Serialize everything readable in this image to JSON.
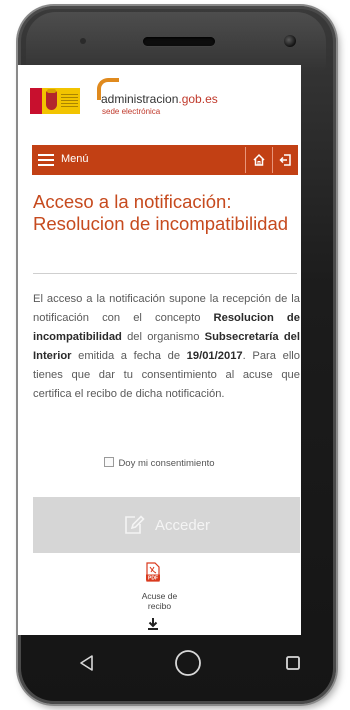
{
  "header": {
    "brand_main": "administracion",
    "brand_suffix": ".gob.es",
    "brand_sub": "sede electrónica"
  },
  "menubar": {
    "menu_label": "Menú",
    "color": "#c24014"
  },
  "page": {
    "title": "Acceso a la notificación: Resolucion de incompatibilidad",
    "title_color": "#c64a1e"
  },
  "paragraph": {
    "part1": "El acceso a la notificación supone la recepción de la notificación con el concepto ",
    "concept": "Resolucion de incompatibilidad",
    "part2": " del organismo ",
    "organism": "Subsecretaría del Interior",
    "part3": " emitida a fecha de ",
    "date": "19/01/2017",
    "part4": ". Para ello tienes que dar tu consentimiento al acuse que certifica el recibo de dicha notificación."
  },
  "consent": {
    "label": "Doy mi consentimiento",
    "checked": false
  },
  "acceder": {
    "label": "Acceder",
    "enabled": false
  },
  "acuse": {
    "line1": "Acuse de",
    "line2": "recibo",
    "pdf_badge": "PDF"
  },
  "icons": {
    "menu": "hamburger-icon",
    "home": "home-icon",
    "logout": "logout-icon",
    "edit": "edit-icon",
    "pdf": "pdf-file-icon",
    "download": "download-icon",
    "back": "back-triangle-icon",
    "home_nav": "home-circle-icon",
    "recents": "recents-square-icon"
  }
}
